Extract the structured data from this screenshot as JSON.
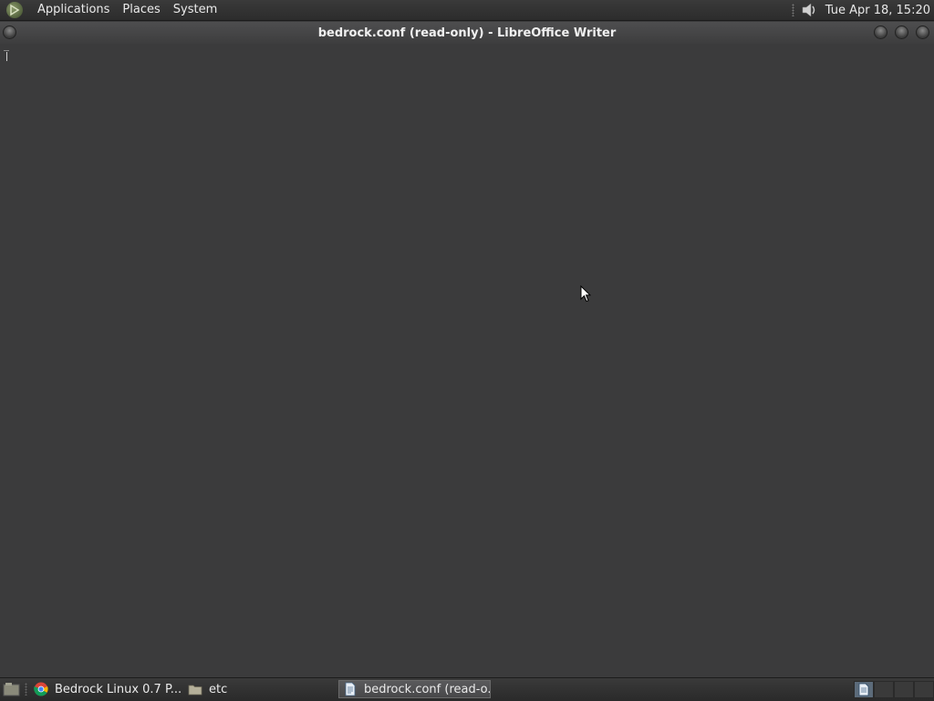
{
  "top_panel": {
    "menus": [
      "Applications",
      "Places",
      "System"
    ],
    "clock": "Tue Apr 18, 15:20"
  },
  "window": {
    "title": "bedrock.conf (read-only) - LibreOffice Writer"
  },
  "taskbar": {
    "items": [
      {
        "label": "Bedrock Linux 0.7 P...",
        "icon": "chrome-icon",
        "active": false
      },
      {
        "label": "etc",
        "icon": "folder-icon",
        "active": false
      },
      {
        "label": "bedrock.conf (read-o...",
        "icon": "document-icon",
        "active": true
      }
    ],
    "workspaces": 4
  },
  "colors": {
    "background": "#3b3b3c",
    "panel": "#2f2f2f",
    "active_workspace": "#5c6b7a"
  }
}
